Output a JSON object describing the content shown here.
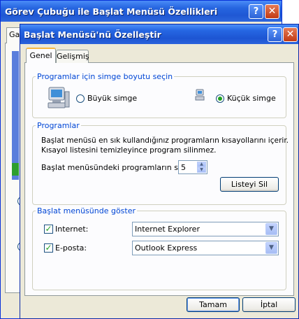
{
  "background_window": {
    "title": "Görev Çubuğu ile Başlat Menüsü Özellikleri",
    "tab_fragment": "Ga",
    "help_glyph": "?",
    "close_glyph": "✕"
  },
  "dialog": {
    "title": "Başlat Menüsü'nü Özelleştir",
    "help_glyph": "?",
    "close_glyph": "✕",
    "tabs": [
      {
        "label": "Genel",
        "active": true
      },
      {
        "label": "Gelişmiş",
        "active": false
      }
    ],
    "icon_size_group": {
      "legend": "Programlar için simge boyutu seçin",
      "large_label": "Büyük simge",
      "small_label": "Küçük simge",
      "selected": "small"
    },
    "programs_group": {
      "legend": "Programlar",
      "description": [
        "Başlat menüsü en sık kullandığınız programların kısayollarını içerir.",
        "Kısayol listesini temizleyince program silinmez."
      ],
      "count_label": "Başlat menüsündeki programların sayısı:",
      "count_value": "5",
      "clear_button": "Listeyi Sil"
    },
    "show_group": {
      "legend": "Başlat menüsünde göster",
      "internet": {
        "label": "Internet:",
        "checked": true,
        "value": "Internet Explorer"
      },
      "email": {
        "label": "E-posta:",
        "checked": true,
        "value": "Outlook Express"
      }
    },
    "ok_button": "Tamam",
    "cancel_button": "İptal"
  },
  "colors": {
    "titlebar": "#2667e3",
    "group_legend": "#0046d5",
    "dialog_face": "#ece9d8",
    "check_green": "#21a121"
  }
}
